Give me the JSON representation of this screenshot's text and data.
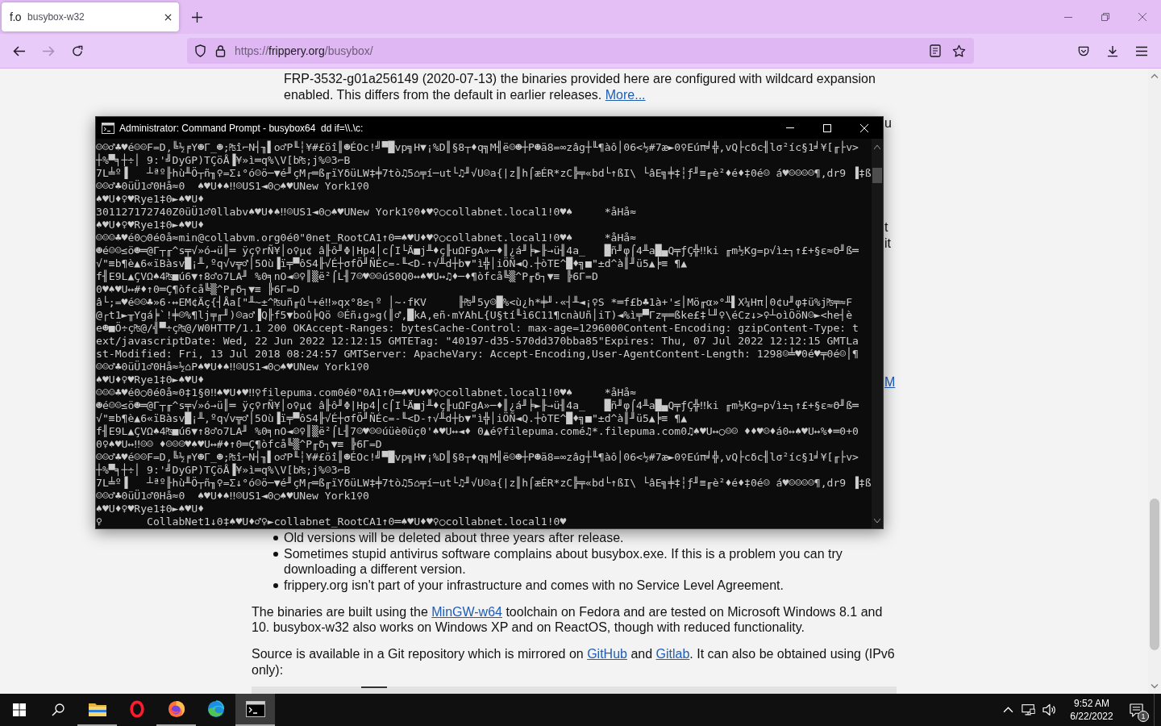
{
  "browser": {
    "tab": {
      "favicon": "f.o",
      "title": "busybox-w32",
      "selected": true
    },
    "nav": {
      "forward_disabled": true
    },
    "url": {
      "scheme": "https://",
      "host": "frippery.org",
      "path": "/busybox/"
    }
  },
  "page": {
    "top_item": [
      {
        "kind": "text",
        "text": "FRP-3532-g01a256149 (2020-07-13) the binaries provided here are configured with wildcard expansion enabled. This differs from the default in earlier releases. "
      },
      {
        "kind": "link",
        "text": "More..."
      }
    ],
    "peek_fragments": [
      {
        "kind": "text",
        "text": "u"
      },
      {
        "kind": "text",
        "text": "t it"
      },
      {
        "kind": "link",
        "text": "M"
      }
    ],
    "bullets": [
      "Old versions will be deleted about three years after release.",
      "Sometimes stupid antivirus software complains about busybox.exe. If this is a problem you can try downloading a different version.",
      "frippery.org isn't part of your infrastructure and comes with no Service Level Agreement."
    ],
    "paragraphs": [
      [
        {
          "kind": "text",
          "text": "The binaries are built using the "
        },
        {
          "kind": "link",
          "text": "MinGW-w64"
        },
        {
          "kind": "text",
          "text": " toolchain on Fedora and are tested on Microsoft Windows 8.1 and 10. busybox-w32 also works on Windows XP and on ReactOS, though with reduced functionality."
        }
      ],
      [
        {
          "kind": "text",
          "text": "Source is available in a Git repository which is mirrored on "
        },
        {
          "kind": "link",
          "text": "GitHub"
        },
        {
          "kind": "text",
          "text": " and "
        },
        {
          "kind": "link",
          "text": "Gitlab"
        },
        {
          "kind": "text",
          "text": ". It can also be obtained using (IPv6 only):"
        }
      ]
    ]
  },
  "console": {
    "title": "Administrator: Command Prompt - busybox64  dd if=\\\\.\\c:",
    "lines": [
      "☺☺♂♣♥é☺☺F=D,╚½╒Y☻Γ_☻;₧î⌐N┤╖▌o♂P╙┆¥#£öî║☻ÉOc!╝▀█vp╗H▼¡%D║§8┬♦q╗M╢ë☺☻┼P☻ä8=∞zâg┼╙¶àô│06<½#7æ►0♀Eúπ╛╬,vQ├cδc╢lσ²íc§1╛¥[╓├v>",
      "┼%▀╕┼÷│ 9:'╝DyGP)TÇöÅ▐¥»ì═q%\\V[b₧;j%☺3⌐B",
      "7L╧º▐   ┴ªº╟hù╨Ö┬ñ╖♀=Σ↓°ó☺ö─▼é╜çM┌═ß╓ïYδüLW‡╪7tò♫5⌂╤í─ut└♫╜√U☺a{|z║h⌠æÉR*zC╠╤«bd└↑ßI\\ └âE╗╪‡┆ƒ╜≡╓è²♦é♦‡0é☺ á♥☺☺☺☺¶,dr9 ▐‡ß",
      "☺☺♂♣0üÜ1♂0Hå≈0  ♠♥U♦♠‼☺US1◄0○♠♥UNew York1♀0",
      "♠♥U♦♀♥Rye1‡0►♠♥U♦",
      "301127172740Z0üÜ1♂0llabv♠♥U♦♠‼☺US1◄0○♠♥UNew York1♀0♦♥♀○collabnet.local1!0♥♠     *åHå≈",
      "♠♥U♦♀♥Rye1‡0►♠♥U♦",
      "☺☺☺♣♥é0○0é0å≈min@collabvm.org0é0\"0net_RootCA1↑0═♠♥U♦♥♀○collabnet.local1!0♥♠     *åHå≈",
      "☻é☺☺≤ö☻═@Γ┬╓^s╤√»ó→ü║═ ÿç♀rÑ¥│o♀µ¢ â╟ô╜Φ|Hp4│c⌠I└Ä■j╨♦ç╟uΩFgA»─♦║¿á╜╞►╟→ü╢4a_   █ñ╜φ⌠4╨a█▄Q╤ƒÇ╬‼ki ╓m½Kg=p√ì±┐↑£+§ε≈Θ╜ß═",
      "√\"≡b¶è▲6«ïBàsv█¡╨,ºq√v╦♂│5Où▐ï╤▀ôS4╟√É┼σfÖ╜ÑÉc=-╙<D-↑√╨d┼b▼\"ì╬│iÖÑ◄Q.┼òTE^█♦╗■\"±d^à║╜ü5▲╞≡ ¶▲",
      "f╢E9L▲ÇVΩ♠4₧■ú6▼↑8♂o7LA╜ %0╕nO◄☺♀║▒ë²⌠L╢7☺♥☺☺úS0Q0↔♠♥U↔♫♦─♦¶òfcå╚▒^P╓δ┐▼≡ ╠6Γ=D",
      "0♥♠♥U↔#♦↑0═Ç¶òfcå╚▒^P╓δ┐▼≡ ╠6Γ=D",
      "â└;=♥é☺☺♣»6·↔EM¢Äç{┤Åa[\"╨~±^₧uñ╓û└+é‼»qx°8≤┐º │~·fKV     ╟₧╜5y☺█%<ù¿h*╪╜·«┤╨◄¡♀S *═f£b♣1à+'≤│Mö╓α»°╨▌X¼Hπ│0¢u╜φ‡ü%j₧╤≈F",
      "@┌t1►╥Ygá╞`!╪☺%¶lj╤╓╜)☺a♂▐Q╟f5▼boû╞Qö ☺Éñ↓g»g(║♂,█kA,eñ·mYAhL{U§tí╙ì6C11¶cnàUñ│iT)◄%ì╤▀Γz╤═ßke£‡└╜♀\\éCz↓>♀┴oìÖöN☺►<he┤è",
      "e☻■Ö÷ç₧@/╣▀÷ç₧@/W0HTTP/1.1 200 OKAccept-Ranges: bytesCache-Control: max-age=1296000Content-Encoding: gzipContent-Type: t",
      "ext/javascriptDate: Wed, 22 Jun 2022 12:12:15 GMTETag: \"40197-d35-570dd370bba85\"Expires: Thu, 07 Jul 2022 12:12:15 GMTLa",
      "st-Modified: Fri, 13 Jul 2018 08:24:57 GMTServer: ApacheVary: Accept-Encoding,User-AgentContent-Length: 1298☺╧♥0é♥╤0é☺│¶",
      "☺☺♂♣0üÜ1♂0Hå≈½⌂P♠♥U♦♠‼☺US1◄0○♠♥UNew York1♀0",
      "♠♥U♦♀♥Rye1‡0►♠♥U♦",
      "☺☺☺♣♥é0○0é0å≈0‡1§0‼♠♥U♦♥‼♀filepuma.com0é0\"0A1↑0═♠♥U♦♥♀○collabnet.local1!0♥♠     *åHå≈",
      "☻é☺☺≤ö☻═@Γ┬╓^s╤√»ó→ü║═ ÿç♀rÑ¥│o♀µ¢ â╟ô╜Φ|Hp4│c⌠I└Ä■j╨♦ç╟uΩFgA»─♦║¿á╜╞►╟→ü╢4a_   █ñ╜φ⌠4╨a█▄Q╤ƒÇ╬‼ki ╓m½Kg=p√ì±┐↑£+§ε≈Θ╜ß═",
      "√\"≡b¶è▲6«ïBàsv█¡╨,ºq√v╦♂│5Où▐ï╤▀ôS4╟√É┼σfÖ╜ÑÉc=-╙<D-↑√╨d┼b▼\"ì╬│iÖÑ◄Q.┼òTE^█♦╗■\"±d^à║╜ü5▲╞≡ ¶▲",
      "f╢E9L▲ÇVΩ♠4₧■ú6▼↑8♂o7LA╜ %0╕nO◄☺♀║▒ë²⌠L╢7☺♥☺☺úüè0üç0'♠♥U↔◄♦ 0▲é♀filepuma.comé♫*.filepuma.com0♫♠♥U↔○☺☺ ♦♦♥☺♦á0↔♠♥U↔%♦═0+0",
      "0♀♠♥U↔‼☺☺ ♦☺☺☺♥♠♥U↔#♦↑0═Ç¶òfcå╚▒^P╓δ┐▼≡ ╠6Γ=D",
      "☺☺♂♣♥é☺☺F=D,╚½╒Y☻Γ_☻;₧î⌐N┤╖▌o♂P╙┆¥#£öî║☻ÉOc!╝▀█vp╗H▼¡%D║§8┬♦q╗M╢ë☺☻┼P☻ä8=∞zâg┼╙¶àô│06<½#7æ►0♀Eúπ╛╬,vQ├cδc╢lσ²íc§1╛¥[╓├v>",
      "┼%▀╕┼÷│ 9:'╝DyGP)TÇöÅ▐¥»ì═q%\\V[b₧;j%☺3⌐B",
      "7L╧º▐   ┴ªº╟hù╨Ö┬ñ╖♀=Σ↓°ó☺ö─▼é╜çM┌═ß╓ïYδüLW‡╪7tò♫5⌂╤í─ut└♫╜√U☺a{|z║h⌠æÉR*zC╠╤«bd└↑ßI\\ └âE╗╪‡┆ƒ╜≡╓è²♦é♦‡0é☺ á♥☺☺☺☺¶,dr9 ▐‡ß",
      "☺☺♂♣0üÜ1♂0Hå≈0  ♠♥U♦♠‼☺US1◄0○♠♥UNew York1♀0",
      "♠♥U♦♀♥Rye1‡0►♠♥U♦",
      "♀       CollabNet1↓0‡♠♥U♦♂♀►collabnet_RootCA1↑0═♠♥U♦♥♀○collabnet.local1!0♥"
    ]
  },
  "taskbar": {
    "apps": [
      {
        "kind": "explorer",
        "running": true,
        "active": false
      },
      {
        "kind": "opera",
        "running": false,
        "active": false
      },
      {
        "kind": "firefox",
        "running": true,
        "active": false
      },
      {
        "kind": "edge",
        "running": false,
        "active": false
      },
      {
        "kind": "terminal",
        "running": true,
        "active": true
      }
    ],
    "time": "9:52 AM",
    "date": "6/22/2022",
    "notification_count": "1"
  }
}
